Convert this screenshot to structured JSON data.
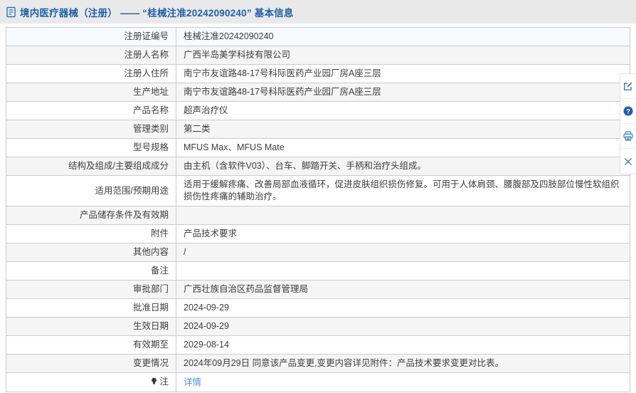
{
  "header": {
    "icon": "document-icon",
    "title": "境内医疗器械（注册） —— “桂械注准20242090240” 基本信息"
  },
  "table": {
    "rows": [
      {
        "label": "注册证编号",
        "value": "桂械注准20242090240"
      },
      {
        "label": "注册人名称",
        "value": "广西半岛美学科技有限公司"
      },
      {
        "label": "注册人住所",
        "value": "南宁市友谊路48-17号科际医药产业园厂房A座三层"
      },
      {
        "label": "生产地址",
        "value": "南宁市友谊路48-17号科际医药产业园厂房A座三层"
      },
      {
        "label": "产品名称",
        "value": "超声治疗仪"
      },
      {
        "label": "管理类别",
        "value": "第二类"
      },
      {
        "label": "型号规格",
        "value": "MFUS Max、MFUS Mate"
      },
      {
        "label": "结构及组成/主要组成成分",
        "value": "由主机（含软件V03）、台车、脚踏开关、手柄和治疗头组成。"
      },
      {
        "label": "适用范围/预期用途",
        "value": "适用于缓解疼痛、改善局部血液循环，促进皮肤组织损伤修复。可用于人体肩颈、腰腹部及四肢部位慢性软组织损伤性疼痛的辅助治疗。"
      },
      {
        "label": "产品储存条件及有效期",
        "value": ""
      },
      {
        "label": "附件",
        "value": "产品技术要求"
      },
      {
        "label": "其他内容",
        "value": "/"
      },
      {
        "label": "备注",
        "value": ""
      },
      {
        "label": "审批部门",
        "value": "广西壮族自治区药品监督管理局"
      },
      {
        "label": "批准日期",
        "value": "2024-09-29"
      },
      {
        "label": "生效日期",
        "value": "2024-09-29"
      },
      {
        "label": "有效期至",
        "value": "2029-08-14"
      },
      {
        "label": "变更情况",
        "value": "2024年09月29日 同意该产品变更,变更内容详见附件：产品技术要求变更对比表。"
      },
      {
        "label": "注",
        "label_icon": "bulb-icon",
        "value": "详情",
        "value_is_link": true
      }
    ]
  },
  "toolbar": {
    "buttons": [
      {
        "icon": "edit-icon"
      },
      {
        "icon": "help-icon"
      },
      {
        "icon": "print-icon"
      },
      {
        "icon": "close-icon"
      }
    ]
  },
  "colors": {
    "topbar_bg": "#e9e9e9",
    "title_blue": "#1d5fa9",
    "table_border": "#cccccc",
    "row_stripe": "#f5f5f5",
    "first_row_highlight": "#f8fbfd",
    "link_blue": "#4a90d9",
    "toolbar_icon_blue": "#3c7dc1",
    "help_circle_blue": "#1c5fae"
  }
}
